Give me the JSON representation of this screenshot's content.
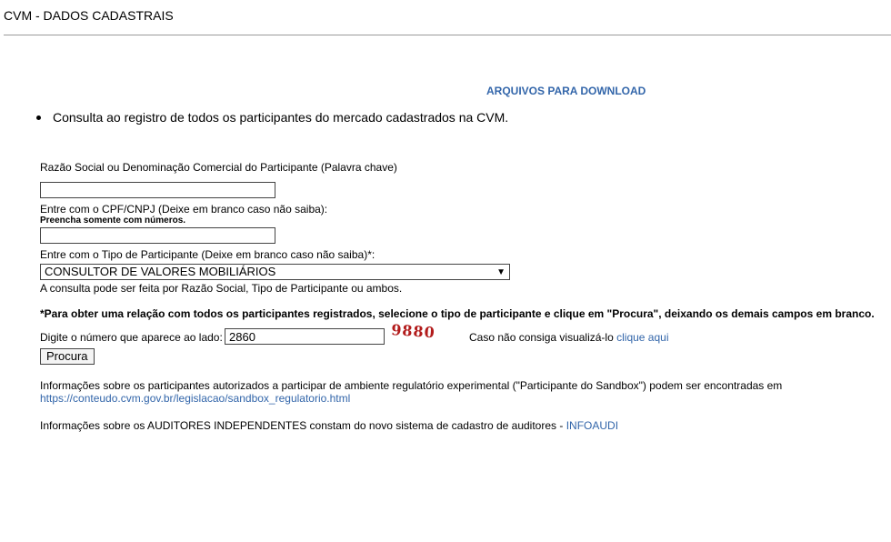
{
  "header": {
    "title": "CVM - DADOS CADASTRAIS"
  },
  "download_link": "ARQUIVOS PARA DOWNLOAD",
  "bullet": "Consulta ao registro de todos os participantes do mercado cadastrados na CVM.",
  "form": {
    "razao_label": "Razão Social ou Denominação Comercial do Participante (Palavra chave)",
    "razao_value": "",
    "cpf_label": "Entre com o CPF/CNPJ (Deixe em branco caso não saiba):",
    "cpf_hint": "Preencha somente com números.",
    "cpf_value": "",
    "tipo_label": "Entre com o Tipo de Participante (Deixe em branco caso não saiba)*:",
    "tipo_selected": "CONSULTOR DE VALORES MOBILIÁRIOS",
    "consulta_note": "A consulta pode ser feita por Razão Social, Tipo de Participante ou ambos.",
    "bold_note": "*Para obter uma relação com todos os participantes registrados, selecione o tipo de participante e clique em \"Procura\", deixando os demais campos em branco.",
    "captcha_label": "Digite o número que aparece ao lado:",
    "captcha_value": "2860",
    "captcha_image_text": "9880",
    "captcha_help_text": "Caso não consiga visualizá-lo",
    "captcha_help_link": "clique aqui",
    "submit_label": "Procura"
  },
  "info": {
    "sandbox_text": "Informações sobre os participantes autorizados a participar de ambiente regulatório experimental (\"Participante do Sandbox\") podem ser encontradas em",
    "sandbox_link": "https://conteudo.cvm.gov.br/legislacao/sandbox_regulatorio.html",
    "auditores_text": "Informações sobre os AUDITORES INDEPENDENTES constam do novo sistema de cadastro de auditores -",
    "auditores_link": "INFOAUDI"
  },
  "colors": {
    "link": "#3366aa",
    "captcha": "#b21b1b",
    "rule": "#9a9a9a"
  },
  "icons": {
    "select_arrow": "chevron-down-icon"
  }
}
